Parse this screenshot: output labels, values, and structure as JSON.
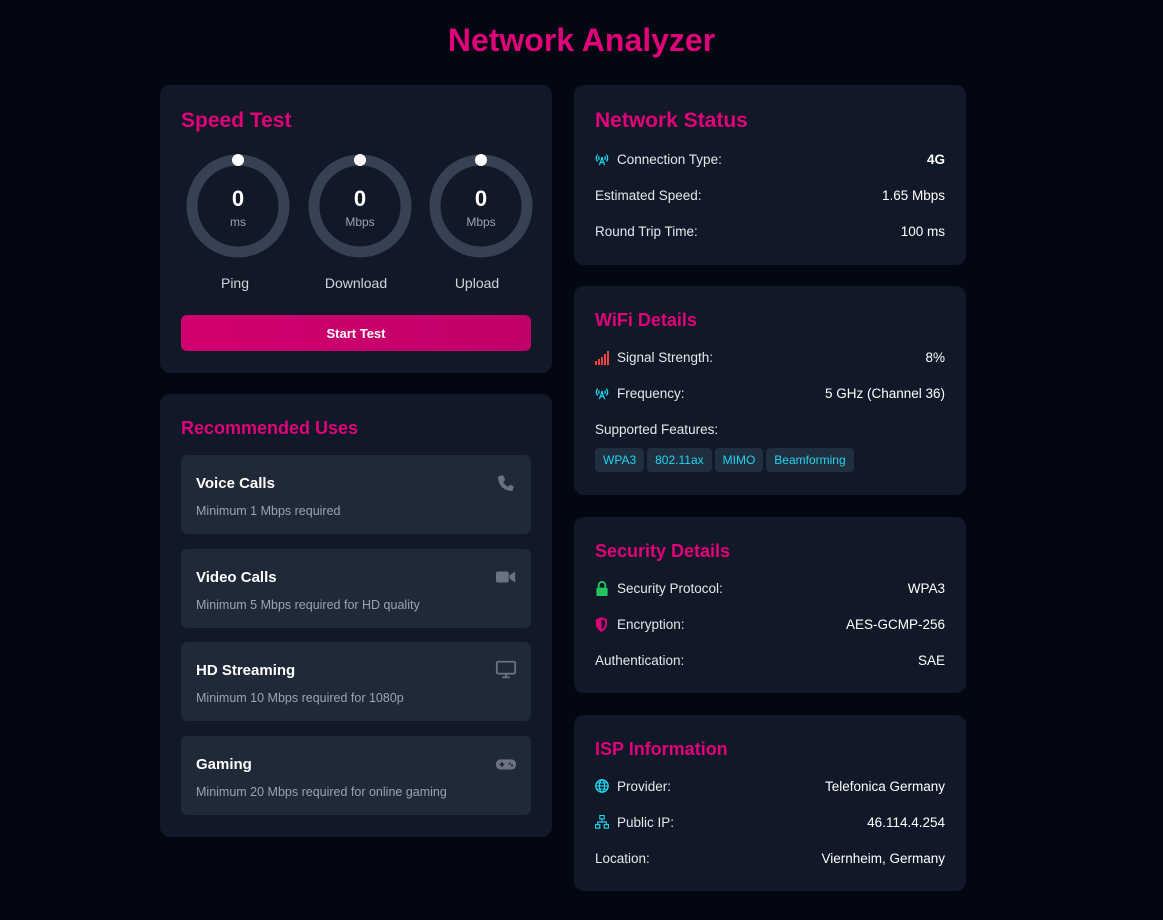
{
  "title": "Network Analyzer",
  "speed_test": {
    "title": "Speed Test",
    "gauges": [
      {
        "value": "0",
        "unit": "ms",
        "label": "Ping"
      },
      {
        "value": "0",
        "unit": "Mbps",
        "label": "Download"
      },
      {
        "value": "0",
        "unit": "Mbps",
        "label": "Upload"
      }
    ],
    "start_label": "Start Test"
  },
  "recommended": {
    "title": "Recommended Uses",
    "items": [
      {
        "title": "Voice Calls",
        "desc": "Minimum 1 Mbps required",
        "icon": "phone-icon"
      },
      {
        "title": "Video Calls",
        "desc": "Minimum 5 Mbps required for HD quality",
        "icon": "video-camera-icon"
      },
      {
        "title": "HD Streaming",
        "desc": "Minimum 10 Mbps required for 1080p",
        "icon": "monitor-icon"
      },
      {
        "title": "Gaming",
        "desc": "Minimum 20 Mbps required for online gaming",
        "icon": "gamepad-icon"
      }
    ]
  },
  "network_status": {
    "title": "Network Status",
    "connection_type": {
      "label": "Connection Type:",
      "value": "4G",
      "icon": "antenna-icon"
    },
    "estimated_speed": {
      "label": "Estimated Speed:",
      "value": "1.65 Mbps"
    },
    "round_trip": {
      "label": "Round Trip Time:",
      "value": "100 ms"
    }
  },
  "wifi": {
    "title": "WiFi Details",
    "signal": {
      "label": "Signal Strength:",
      "value": "8%",
      "icon": "signal-bars-icon"
    },
    "frequency": {
      "label": "Frequency:",
      "value": "5 GHz (Channel 36)",
      "icon": "antenna-icon"
    },
    "features_label": "Supported Features:",
    "features": [
      "WPA3",
      "802.11ax",
      "MIMO",
      "Beamforming"
    ]
  },
  "security": {
    "title": "Security Details",
    "protocol": {
      "label": "Security Protocol:",
      "value": "WPA3",
      "icon": "lock-icon"
    },
    "encryption": {
      "label": "Encryption:",
      "value": "AES-GCMP-256",
      "icon": "shield-icon"
    },
    "authentication": {
      "label": "Authentication:",
      "value": "SAE"
    }
  },
  "isp": {
    "title": "ISP Information",
    "provider": {
      "label": "Provider:",
      "value": "Telefonica Germany",
      "icon": "globe-icon"
    },
    "public_ip": {
      "label": "Public IP:",
      "value": "46.114.4.254",
      "icon": "network-icon"
    },
    "location": {
      "label": "Location:",
      "value": "Viernheim, Germany"
    }
  },
  "colors": {
    "accent": "#e0037a",
    "background": "#030712",
    "card": "#111827",
    "item": "#1f2937",
    "cyan": "#22d3ee",
    "green": "#22c55e"
  }
}
